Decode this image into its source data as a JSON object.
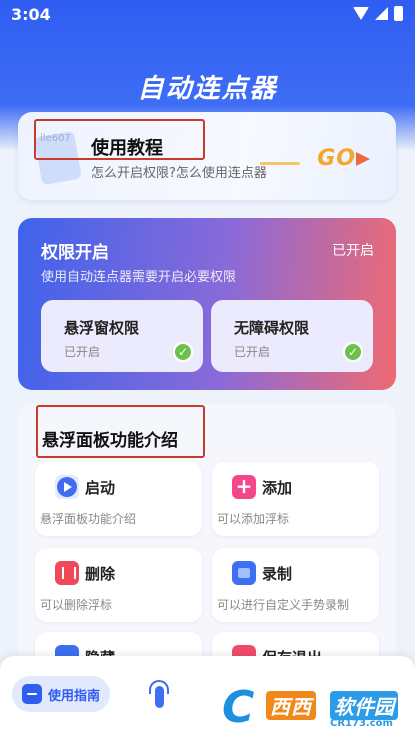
{
  "status_bar": {
    "time": "3:04"
  },
  "app": {
    "title": "自动连点器"
  },
  "tutorial": {
    "watermark": "ile607",
    "title": "使用教程",
    "subtitle": "怎么开启权限?怎么使用连点器",
    "go": "GO"
  },
  "permissions": {
    "title": "权限开启",
    "state": "已开启",
    "description": "使用自动连点器需要开启必要权限",
    "items": [
      {
        "label": "悬浮窗权限",
        "status": "已开启"
      },
      {
        "label": "无障碍权限",
        "status": "已开启"
      }
    ]
  },
  "features": {
    "title": "悬浮面板功能介绍",
    "items": [
      {
        "name": "启动",
        "desc": "悬浮面板功能介绍",
        "icon": "play-icon"
      },
      {
        "name": "添加",
        "desc": "可以添加浮标",
        "icon": "add-icon"
      },
      {
        "name": "删除",
        "desc": "可以删除浮标",
        "icon": "trash-icon"
      },
      {
        "name": "录制",
        "desc": "可以进行自定义手势录制",
        "icon": "record-icon"
      },
      {
        "name": "隐藏",
        "desc": "",
        "icon": "hide-icon"
      },
      {
        "name": "保存退出",
        "desc": "",
        "icon": "exit-icon"
      }
    ]
  },
  "bottom_nav": {
    "guide_label": "使用指南",
    "tap_icon": "tap-icon"
  },
  "watermark": {
    "brand_cn": "西西",
    "brand_cn2": "软件园",
    "url": "CR173.com"
  },
  "colors": {
    "primary": "#2f5df2",
    "gradient_start": "#3f63ec",
    "gradient_end": "#ef6a72",
    "check": "#6ac24a",
    "highlight_box": "#c83a2a"
  }
}
